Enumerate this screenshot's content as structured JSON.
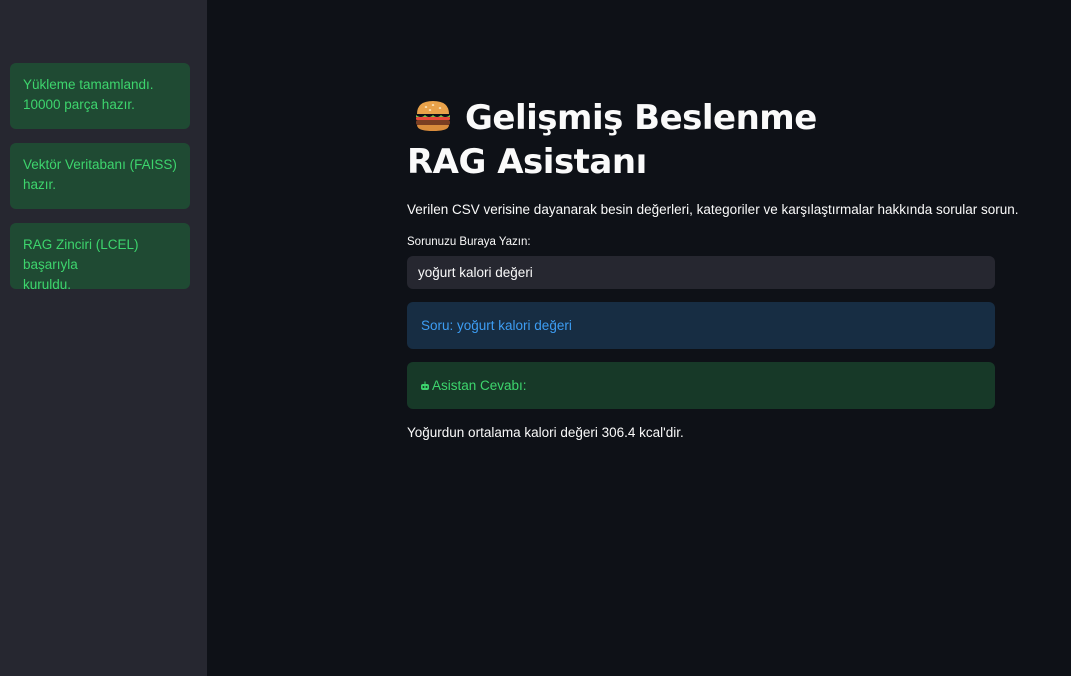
{
  "sidebar": {
    "status_messages": [
      {
        "line1": "Yükleme tamamlandı.",
        "line2": "10000 parça hazır."
      },
      {
        "line1": "Vektör Veritabanı (FAISS)",
        "line2": "hazır."
      },
      {
        "line1": "RAG Zinciri (LCEL) başarıyla",
        "line2": "kuruldu."
      }
    ]
  },
  "main": {
    "title_icon": "hamburger-emoji",
    "title": "Gelişmiş Beslenme RAG Asistanı",
    "description": "Verilen CSV verisine dayanarak besin değerleri, kategoriler ve karşılaştırmalar hakkında sorular sorun.",
    "input_label": "Sorunuzu Buraya Yazın:",
    "input_value": "yoğurt kalori değeri",
    "question_info": "Soru: yoğurt kalori değeri",
    "answer_header": "Asistan Cevabı:",
    "answer_icon": "robot-icon",
    "answer_text": "Yoğurdun ortalama kalori değeri 306.4 kcal'dir."
  },
  "colors": {
    "sidebar_bg": "#262730",
    "main_bg": "#0e1117",
    "success_text": "#3dd56d",
    "info_text": "#3d9df3",
    "info_bg": "#172d43",
    "success_bg": "#173928"
  }
}
